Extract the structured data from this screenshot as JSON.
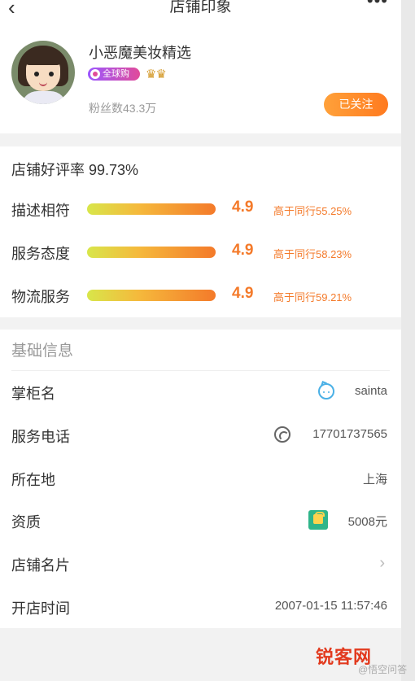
{
  "nav": {
    "back_icon": "chevron-left-icon",
    "title": "店铺印象",
    "more_icon": "more-dots-icon"
  },
  "shop": {
    "name": "小恶魔美妆精选",
    "badge": "全球购",
    "crowns": "♛♛",
    "fans": "粉丝数43.3万",
    "follow_label": "已关注"
  },
  "ratings": {
    "good_rate": "店铺好评率 99.73%",
    "items": [
      {
        "label": "描述相符",
        "score": "4.9",
        "compare": "高于同行55.25%"
      },
      {
        "label": "服务态度",
        "score": "4.9",
        "compare": "高于同行58.23%"
      },
      {
        "label": "物流服务",
        "score": "4.9",
        "compare": "高于同行59.21%"
      }
    ]
  },
  "info": {
    "header": "基础信息",
    "rows": [
      {
        "key": "掌柜名",
        "value": "sainta",
        "icon": "robot-icon"
      },
      {
        "key": "服务电话",
        "value": "17701737565",
        "icon": "phone-icon"
      },
      {
        "key": "所在地",
        "value": "上海"
      },
      {
        "key": "资质",
        "value": "5008元",
        "icon": "certificate-icon"
      },
      {
        "key": "店铺名片",
        "value": "",
        "icon": "chevron-right-icon"
      },
      {
        "key": "开店时间",
        "value": "2007-01-15 11:57:46"
      }
    ]
  },
  "watermark": {
    "text": "锐客网",
    "sub": "@悟空问答"
  },
  "colors": {
    "accent": "#f47a2a",
    "follow_start": "#ffa13a",
    "follow_end": "#ff7a1f",
    "background": "#f2f2f2"
  }
}
